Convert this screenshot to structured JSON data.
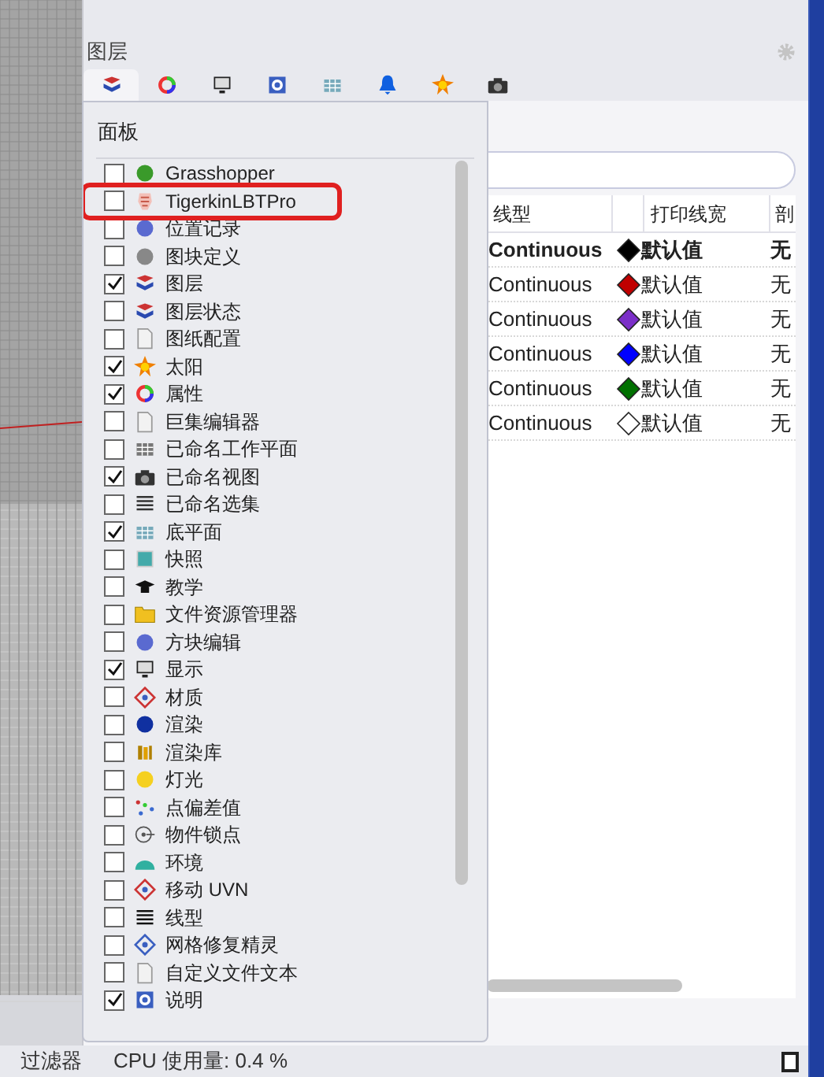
{
  "panel": {
    "title": "图层",
    "tabs": [
      {
        "selected": true
      },
      {
        "selected": false
      },
      {
        "selected": false
      },
      {
        "selected": false
      },
      {
        "selected": false
      },
      {
        "selected": false
      },
      {
        "selected": false
      },
      {
        "selected": false
      }
    ],
    "table": {
      "columns": [
        {
          "label": "线型"
        },
        {
          "label": "打印线宽"
        },
        {
          "label": "剖"
        }
      ],
      "rows": [
        {
          "linetype": "Continuous",
          "color": "#000000",
          "print_width": "默认值",
          "column_4": "无",
          "current": true
        },
        {
          "linetype": "Continuous",
          "color": "#c00000",
          "print_width": "默认值",
          "column_4": "无",
          "current": false
        },
        {
          "linetype": "Continuous",
          "color": "#7b2fc8",
          "print_width": "默认值",
          "column_4": "无",
          "current": false
        },
        {
          "linetype": "Continuous",
          "color": "#0000ff",
          "print_width": "默认值",
          "column_4": "无",
          "current": false
        },
        {
          "linetype": "Continuous",
          "color": "#007000",
          "print_width": "默认值",
          "column_4": "无",
          "current": false
        },
        {
          "linetype": "Continuous",
          "color": "#ffffff",
          "print_width": "默认值",
          "column_4": "无",
          "current": false
        }
      ]
    }
  },
  "panels_menu": {
    "title": "面板",
    "items": [
      {
        "label": "Grasshopper",
        "checked": false,
        "highlighted": false
      },
      {
        "label": "TigerkinLBTPro",
        "checked": false,
        "highlighted": true
      },
      {
        "label": "位置记录",
        "checked": false,
        "highlighted": false
      },
      {
        "label": "图块定义",
        "checked": false,
        "highlighted": false
      },
      {
        "label": "图层",
        "checked": true,
        "highlighted": false
      },
      {
        "label": "图层状态",
        "checked": false,
        "highlighted": false
      },
      {
        "label": "图纸配置",
        "checked": false,
        "highlighted": false
      },
      {
        "label": "太阳",
        "checked": true,
        "highlighted": false
      },
      {
        "label": "属性",
        "checked": true,
        "highlighted": false
      },
      {
        "label": "巨集编辑器",
        "checked": false,
        "highlighted": false
      },
      {
        "label": "已命名工作平面",
        "checked": false,
        "highlighted": false
      },
      {
        "label": "已命名视图",
        "checked": true,
        "highlighted": false
      },
      {
        "label": "已命名选集",
        "checked": false,
        "highlighted": false
      },
      {
        "label": "底平面",
        "checked": true,
        "highlighted": false
      },
      {
        "label": "快照",
        "checked": false,
        "highlighted": false
      },
      {
        "label": "教学",
        "checked": false,
        "highlighted": false
      },
      {
        "label": "文件资源管理器",
        "checked": false,
        "highlighted": false
      },
      {
        "label": "方块编辑",
        "checked": false,
        "highlighted": false
      },
      {
        "label": "显示",
        "checked": true,
        "highlighted": false
      },
      {
        "label": "材质",
        "checked": false,
        "highlighted": false
      },
      {
        "label": "渲染",
        "checked": false,
        "highlighted": false
      },
      {
        "label": "渲染库",
        "checked": false,
        "highlighted": false
      },
      {
        "label": "灯光",
        "checked": false,
        "highlighted": false
      },
      {
        "label": "点偏差值",
        "checked": false,
        "highlighted": false
      },
      {
        "label": "物件锁点",
        "checked": false,
        "highlighted": false
      },
      {
        "label": "环境",
        "checked": false,
        "highlighted": false
      },
      {
        "label": "移动 UVN",
        "checked": false,
        "highlighted": false
      },
      {
        "label": "线型",
        "checked": false,
        "highlighted": false
      },
      {
        "label": "网格修复精灵",
        "checked": false,
        "highlighted": false
      },
      {
        "label": "自定义文件文本",
        "checked": false,
        "highlighted": false
      },
      {
        "label": "说明",
        "checked": true,
        "highlighted": false
      }
    ]
  },
  "status_bar": {
    "filter": "过滤器",
    "cpu": "CPU 使用量: 0.4 %"
  }
}
